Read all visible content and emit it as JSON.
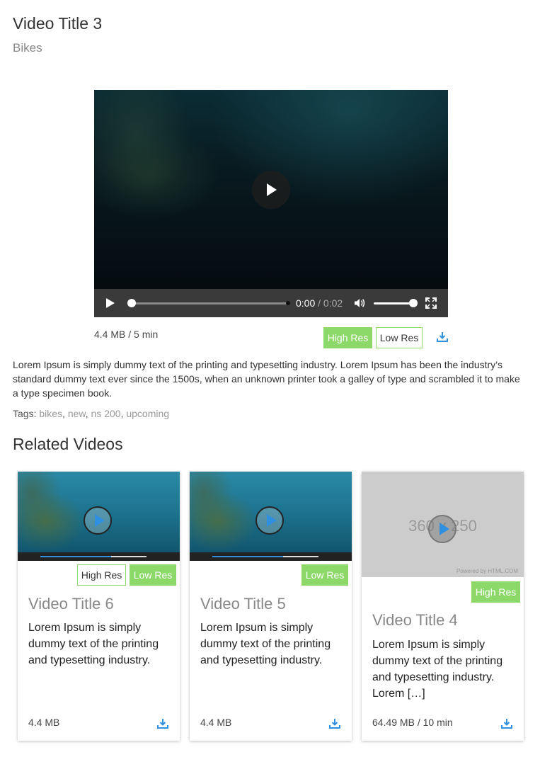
{
  "header": {
    "title": "Video Title 3",
    "category": "Bikes"
  },
  "player": {
    "current_time": "0:00",
    "separator": "/",
    "duration": "0:02",
    "played_fraction": 0.0,
    "volume_fraction": 1.0
  },
  "video_meta": {
    "size": "4.4 MB",
    "separator": "/",
    "length": "5 min"
  },
  "quality": {
    "high": "High Res",
    "low": "Low Res"
  },
  "description": "Lorem Ipsum is simply dummy text of the printing and typesetting industry. Lorem Ipsum has been the industry’s standard dummy text ever since the 1500s, when an unknown printer took a galley of type and scrambled it to make a type specimen book.",
  "tags": {
    "label": "Tags:",
    "items": [
      "bikes",
      "new",
      "ns 200",
      "upcoming"
    ]
  },
  "related": {
    "heading": "Related Videos",
    "cards": [
      {
        "title": "Video Title 6",
        "desc": "Lorem Ipsum is simply dummy text of the printing and typesetting industry.",
        "size": "4.4 MB",
        "high": "High Res",
        "low": "Low Res"
      },
      {
        "title": "Video Title 5",
        "desc": "Lorem Ipsum is simply dummy text of the printing and typesetting industry.",
        "size": "4.4 MB",
        "low": "Low Res"
      },
      {
        "title": "Video Title 4",
        "desc": "Lorem Ipsum is simply dummy text of the printing and typesetting industry. Lorem […]",
        "size": "64.49 MB",
        "separator": "/",
        "length": "10 min",
        "high": "High Res",
        "placeholder_text": "360 x 250",
        "placeholder_footer": "Powered by HTML.COM"
      }
    ]
  },
  "colors": {
    "accent_green": "#8cd96a",
    "download_blue": "#2f8fe0",
    "control_bar": "#3a3a3a"
  },
  "icons": {
    "play": "play-icon",
    "volume": "volume-icon",
    "fullscreen": "fullscreen-icon",
    "download": "download-icon"
  }
}
